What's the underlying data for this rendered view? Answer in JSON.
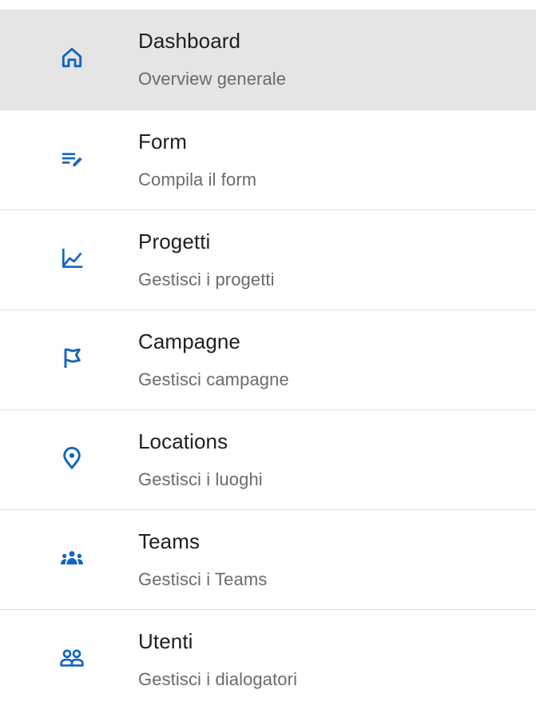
{
  "accent_color": "#1565c0",
  "menu": {
    "items": [
      {
        "title": "Dashboard",
        "subtitle": "Overview generale",
        "icon": "home-icon",
        "selected": true
      },
      {
        "title": "Form",
        "subtitle": "Compila il form",
        "icon": "edit-note-icon",
        "selected": false
      },
      {
        "title": "Progetti",
        "subtitle": "Gestisci i progetti",
        "icon": "line-chart-icon",
        "selected": false
      },
      {
        "title": "Campagne",
        "subtitle": "Gestisci campagne",
        "icon": "flag-icon",
        "selected": false
      },
      {
        "title": "Locations",
        "subtitle": "Gestisci i luoghi",
        "icon": "location-pin-icon",
        "selected": false
      },
      {
        "title": "Teams",
        "subtitle": "Gestisci i Teams",
        "icon": "groups-icon",
        "selected": false
      },
      {
        "title": "Utenti",
        "subtitle": "Gestisci i dialogatori",
        "icon": "people-outline-icon",
        "selected": false
      }
    ]
  }
}
